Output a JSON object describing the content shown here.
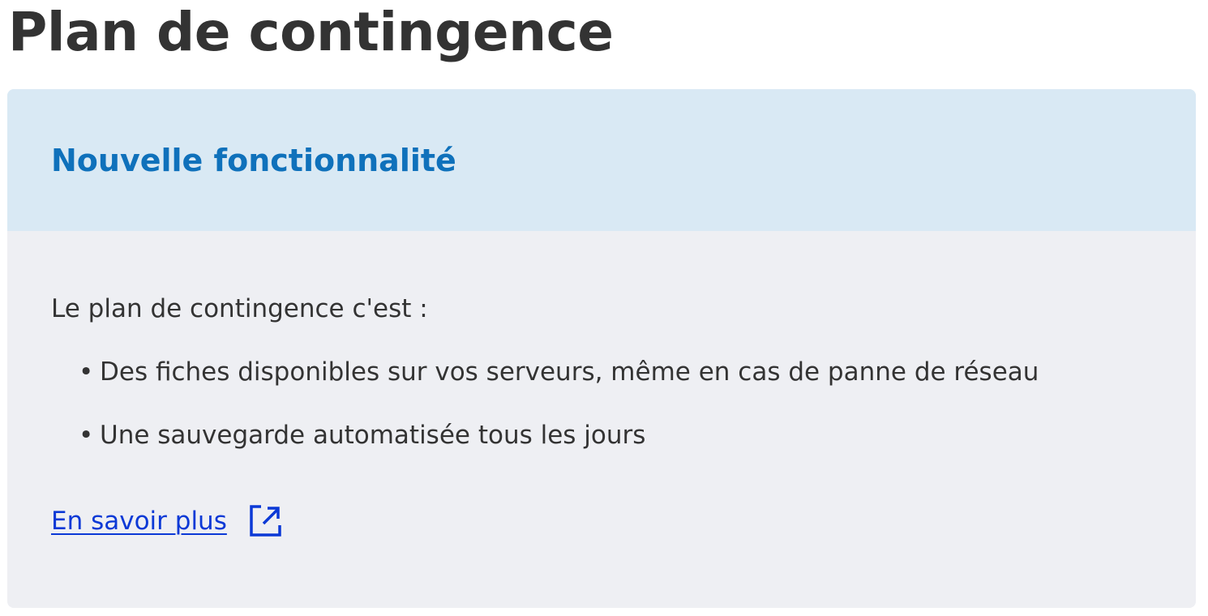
{
  "page": {
    "title": "Plan de contingence"
  },
  "card": {
    "header_title": "Nouvelle fonctionnalité",
    "intro": "Le plan de contingence c'est :",
    "bullet_char": "•",
    "features": [
      "Des fiches disponibles sur vos serveurs, même en cas de panne de réseau",
      "Une sauvegarde automatisée tous les jours"
    ],
    "link": {
      "label": "En savoir plus",
      "icon": "external-link-icon"
    }
  },
  "colors": {
    "title_text": "#333333",
    "header_background": "#d9e9f4",
    "header_text": "#0f71bb",
    "body_background": "#eeeff3",
    "link": "#0b39d6"
  }
}
